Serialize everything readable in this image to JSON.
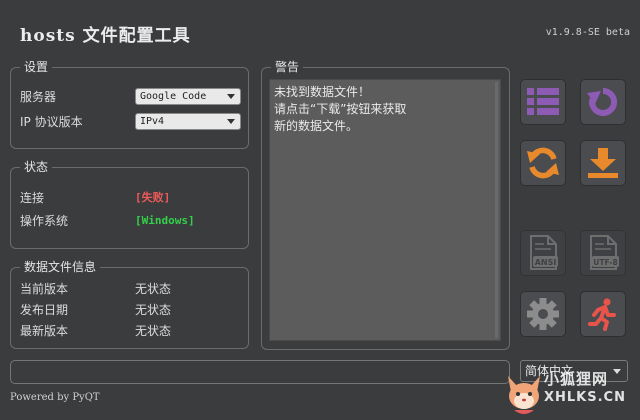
{
  "header": {
    "title": "hosts 文件配置工具",
    "version": "v1.9.8-SE beta"
  },
  "settings": {
    "title": "设置",
    "server_label": "服务器",
    "server_value": "Google Code",
    "ip_label": "IP 协议版本",
    "ip_value": "IPv4"
  },
  "status": {
    "title": "状态",
    "connection_label": "连接",
    "connection_value": "[失败]",
    "os_label": "操作系统",
    "os_value": "[Windows]",
    "colors": {
      "fail": "#ee5a5a",
      "ok": "#33d14a"
    }
  },
  "datafile": {
    "title": "数据文件信息",
    "rows": [
      {
        "label": "当前版本",
        "value": "无状态"
      },
      {
        "label": "发布日期",
        "value": "无状态"
      },
      {
        "label": "最新版本",
        "value": "无状态"
      }
    ]
  },
  "warning": {
    "title": "警告",
    "lines": [
      "未找到数据文件！",
      "请点击“下载”按钮来获取",
      "新的数据文件。"
    ]
  },
  "buttons": {
    "functions_icon": "list-icon",
    "refresh_icon": "rotate-icon",
    "update_icon": "sync-icon",
    "download_icon": "download-icon",
    "export_ansi_icon": "ansi-file-icon",
    "export_ansi_label": "ANSI",
    "export_utf8_icon": "utf8-file-icon",
    "export_utf8_label": "UTF-8",
    "settings_icon": "gear-icon",
    "exit_icon": "runner-icon",
    "colors": {
      "purple": "#8e5bb4",
      "orange": "#e8892c",
      "runner": "#e8534a"
    }
  },
  "language": {
    "selected": "简体中文"
  },
  "footer": {
    "text": "Powered by PyQT"
  },
  "watermark": {
    "text_cn": "小狐狸网",
    "text_en": "XHLKS.CN"
  }
}
